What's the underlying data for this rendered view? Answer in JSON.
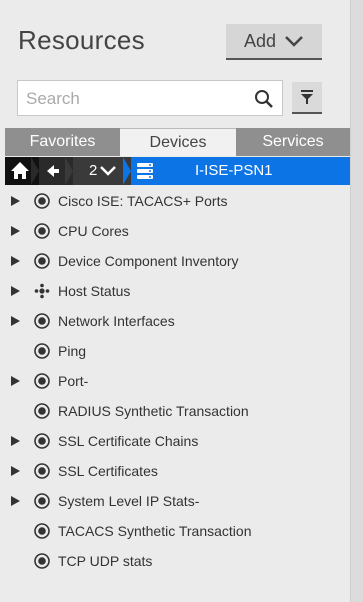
{
  "header": {
    "title": "Resources",
    "add_label": "Add"
  },
  "search": {
    "placeholder": "Search",
    "value": ""
  },
  "tabs": [
    {
      "label": "Favorites",
      "active": false
    },
    {
      "label": "Devices",
      "active": true
    },
    {
      "label": "Services",
      "active": false
    }
  ],
  "breadcrumb": {
    "level": "2",
    "node_label": "I-ISE-PSN1"
  },
  "tree": {
    "items": [
      {
        "label": "Cisco ISE: TACACS+ Ports",
        "expandable": true,
        "icon": "radio-target-icon"
      },
      {
        "label": "CPU Cores",
        "expandable": true,
        "icon": "radio-target-icon"
      },
      {
        "label": "Device Component Inventory",
        "expandable": true,
        "icon": "radio-target-icon"
      },
      {
        "label": "Host Status",
        "expandable": true,
        "icon": "network-cluster-icon"
      },
      {
        "label": "Network Interfaces",
        "expandable": true,
        "icon": "radio-target-icon"
      },
      {
        "label": "Ping",
        "expandable": false,
        "icon": "radio-target-icon"
      },
      {
        "label": "Port-",
        "expandable": true,
        "icon": "radio-target-icon"
      },
      {
        "label": "RADIUS Synthetic Transaction",
        "expandable": false,
        "icon": "radio-target-icon"
      },
      {
        "label": "SSL Certificate Chains",
        "expandable": true,
        "icon": "radio-target-icon"
      },
      {
        "label": "SSL Certificates",
        "expandable": true,
        "icon": "radio-target-icon"
      },
      {
        "label": "System Level IP Stats-",
        "expandable": true,
        "icon": "radio-target-icon"
      },
      {
        "label": "TACACS Synthetic Transaction",
        "expandable": false,
        "icon": "radio-target-icon"
      },
      {
        "label": "TCP UDP stats",
        "expandable": false,
        "icon": "radio-target-icon"
      }
    ]
  },
  "colors": {
    "accent": "#0d74e6",
    "tab_inactive": "#8f8f8f",
    "background": "#ebebeb"
  }
}
